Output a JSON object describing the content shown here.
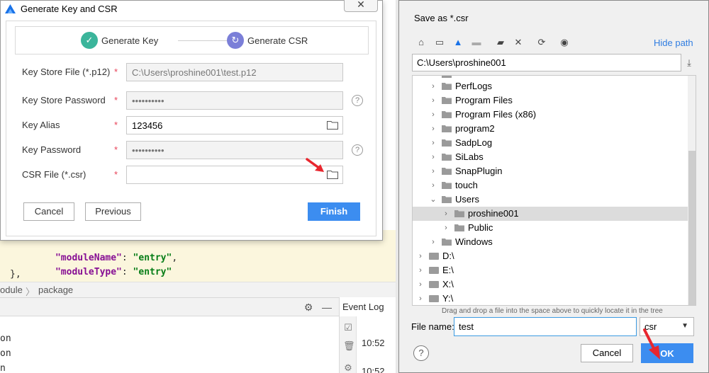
{
  "colors": {
    "accent": "#3c8df0",
    "step_done": "#3bb59b",
    "step_current": "#7b7fd8",
    "required": "#e8445a",
    "arrow": "#e8262e"
  },
  "ide": {
    "code_lines": [
      {
        "key": "\"moduleName\"",
        "sep": ": ",
        "val": "\"entry\"",
        "end": ","
      },
      {
        "key": "\"moduleType\"",
        "sep": ": ",
        "val": "\"entry\"",
        "end": ""
      }
    ],
    "closing_brace": "},",
    "breadcrumb": {
      "module": "odule",
      "sep": "〉",
      "package": "package"
    },
    "run_lines": [
      "on",
      "on",
      "n"
    ],
    "event_log": {
      "title": "Event Log",
      "times": [
        "10:52",
        "10:52"
      ]
    }
  },
  "key_dialog": {
    "title": "Generate Key and CSR",
    "close_icon": "close-icon",
    "steps": [
      {
        "label": "Generate Key",
        "state": "done"
      },
      {
        "label": "Generate CSR",
        "state": "current"
      }
    ],
    "fields": [
      {
        "label": "Key Store File (*.p12)",
        "required": "*",
        "value": "C:\\Users\\proshine001\\test.p12"
      },
      {
        "label": "Key Store Password",
        "required": "*",
        "value": "••••••••••"
      },
      {
        "label": "Key Alias",
        "required": "*",
        "value": "123456"
      },
      {
        "label": "Key Password",
        "required": "*",
        "value": "••••••••••"
      },
      {
        "label": "CSR File (*.csr)",
        "required": "*",
        "value": ""
      }
    ],
    "buttons": {
      "cancel": "Cancel",
      "previous": "Previous",
      "finish": "Finish"
    }
  },
  "save_dialog": {
    "title": "Save as *.csr",
    "hide_path": "Hide path",
    "path": "C:\\Users\\proshine001",
    "tree": [
      {
        "label": "PerfLogs",
        "level": 1
      },
      {
        "label": "Program Files",
        "level": 1
      },
      {
        "label": "Program Files (x86)",
        "level": 1
      },
      {
        "label": "program2",
        "level": 1
      },
      {
        "label": "SadpLog",
        "level": 1
      },
      {
        "label": "SiLabs",
        "level": 1
      },
      {
        "label": "SnapPlugin",
        "level": 1
      },
      {
        "label": "touch",
        "level": 1
      },
      {
        "label": "Users",
        "level": 1,
        "expanded": true
      },
      {
        "label": "proshine001",
        "level": 2,
        "selected": true
      },
      {
        "label": "Public",
        "level": 2
      },
      {
        "label": "Windows",
        "level": 1
      },
      {
        "label": "D:\\",
        "level": 0,
        "drive": true
      },
      {
        "label": "E:\\",
        "level": 0,
        "drive": true
      },
      {
        "label": "X:\\",
        "level": 0,
        "drive": true
      },
      {
        "label": "Y:\\",
        "level": 0,
        "drive": true
      }
    ],
    "hint": "Drag and drop a file into the space above to quickly locate it in the tree",
    "file_name_label": "File name:",
    "file_name": "test",
    "extension": "csr",
    "buttons": {
      "help": "?",
      "cancel": "Cancel",
      "ok": "OK"
    }
  }
}
